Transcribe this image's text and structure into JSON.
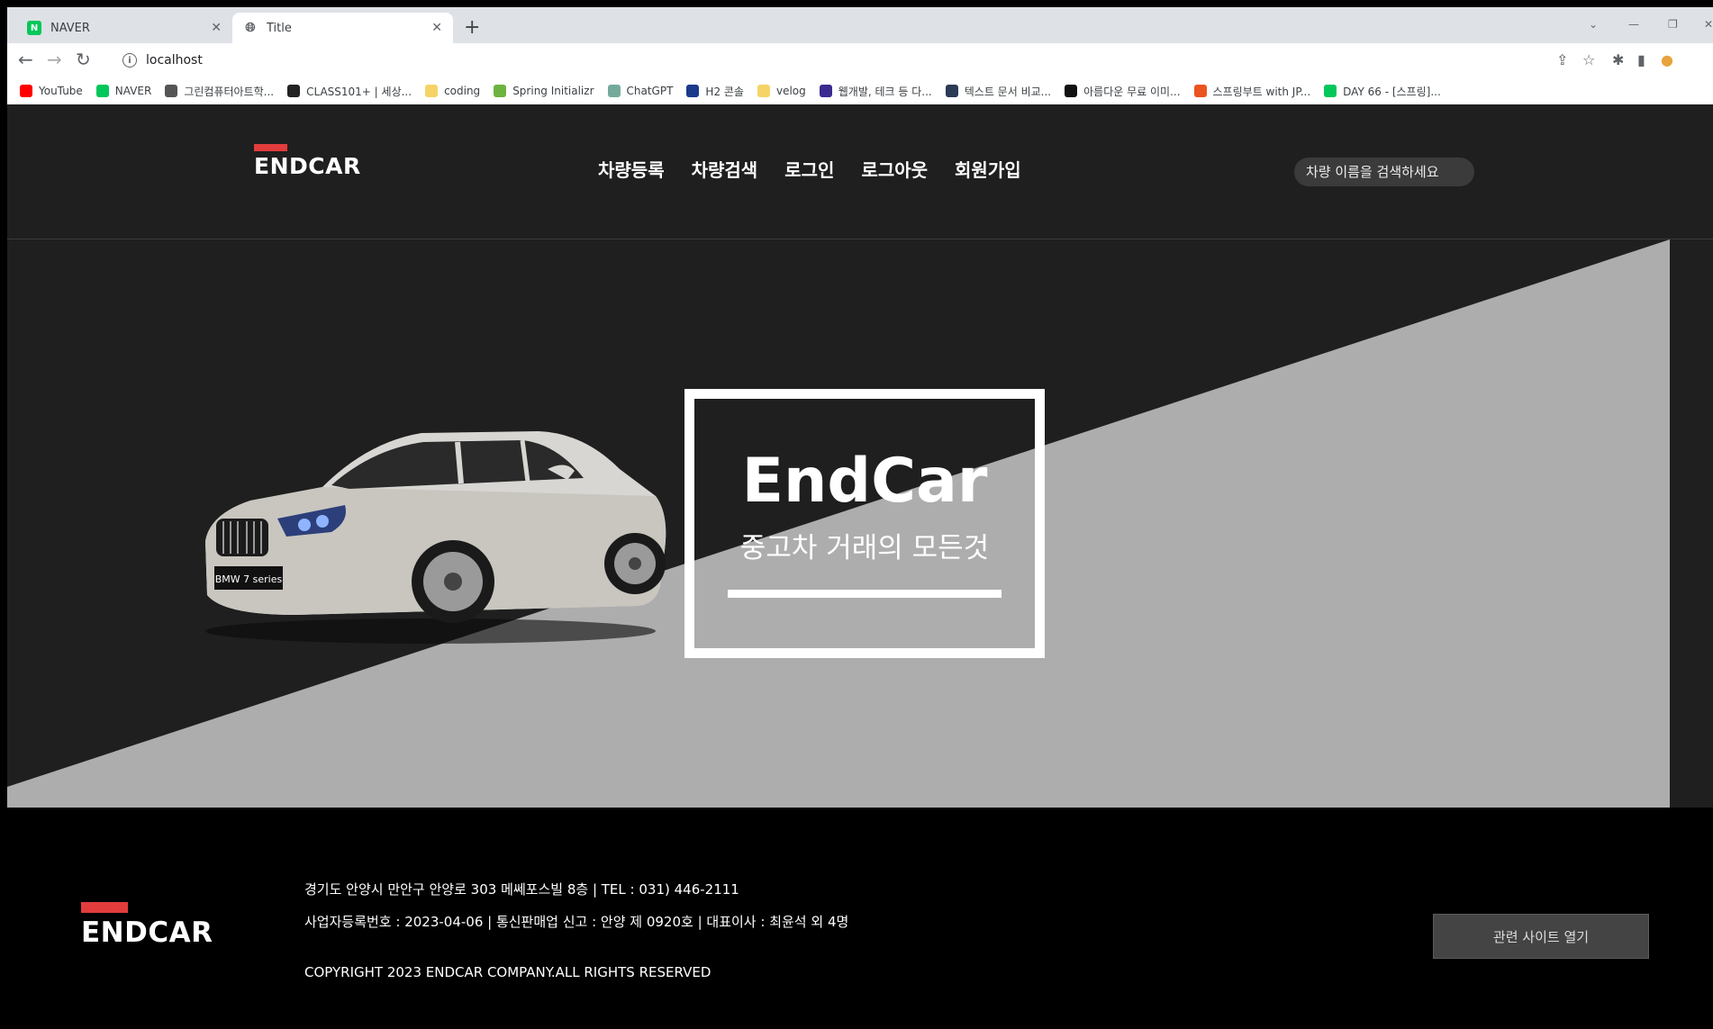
{
  "browser": {
    "tabs": [
      {
        "title": "NAVER",
        "favicon": "naver-icon",
        "active": false
      },
      {
        "title": "Title",
        "favicon": "globe-icon",
        "active": true
      }
    ],
    "address": "localhost",
    "bookmarks": [
      {
        "label": "YouTube",
        "icon": "youtube-icon",
        "color": "#ff0000"
      },
      {
        "label": "NAVER",
        "icon": "naver-icon",
        "color": "#03c75a"
      },
      {
        "label": "그린컴퓨터아트학...",
        "icon": "globe-icon",
        "color": "#555555"
      },
      {
        "label": "CLASS101+ | 세상...",
        "icon": "class101-icon",
        "color": "#222222"
      },
      {
        "label": "coding",
        "icon": "folder-icon",
        "color": "#f6d365"
      },
      {
        "label": "Spring Initializr",
        "icon": "spring-icon",
        "color": "#6db33f"
      },
      {
        "label": "ChatGPT",
        "icon": "chatgpt-icon",
        "color": "#74aa9c"
      },
      {
        "label": "H2 콘솔",
        "icon": "h2-icon",
        "color": "#1b3a8c"
      },
      {
        "label": "velog",
        "icon": "folder-icon",
        "color": "#f6d365"
      },
      {
        "label": "웹개발, 테크 등 다...",
        "icon": "web-icon",
        "color": "#3b2a8f"
      },
      {
        "label": "텍스트 문서 비교...",
        "icon": "diff-icon",
        "color": "#2b3a55"
      },
      {
        "label": "아름다운 무료 이미...",
        "icon": "unsplash-icon",
        "color": "#111111"
      },
      {
        "label": "스프링부트 with JP...",
        "icon": "tistory-icon",
        "color": "#eb531f"
      },
      {
        "label": "DAY 66 - [스프링]...",
        "icon": "blog-icon",
        "color": "#03c75a"
      }
    ]
  },
  "header": {
    "logo": "ENDCAR",
    "menu": [
      "차량등록",
      "차량검색",
      "로그인",
      "로그아웃",
      "회원가입"
    ],
    "search_placeholder": "차량 이름을 검색하세요"
  },
  "hero": {
    "title": "EndCar",
    "subtitle": "중고차 거래의 모든것",
    "car_plate": "BMW 7 series"
  },
  "footer": {
    "logo": "ENDCAR",
    "address": "경기도 안양시 만안구 안양로 303 메쎄포스빌 8층 | TEL : 031) 446-2111",
    "business": "사업자등록번호 : 2023-04-06 | 통신판매업 신고 : 안양 제 0920호 | 대표이사 : 최윤석 외 4명",
    "copyright": "COPYRIGHT 2023 ENDCAR COMPANY.ALL RIGHTS RESERVED",
    "related_button": "관련 사이트 열기"
  },
  "colors": {
    "brand_red": "#e23c3c",
    "header_bg": "#1f1f1f",
    "hero_gray": "#adadad"
  }
}
